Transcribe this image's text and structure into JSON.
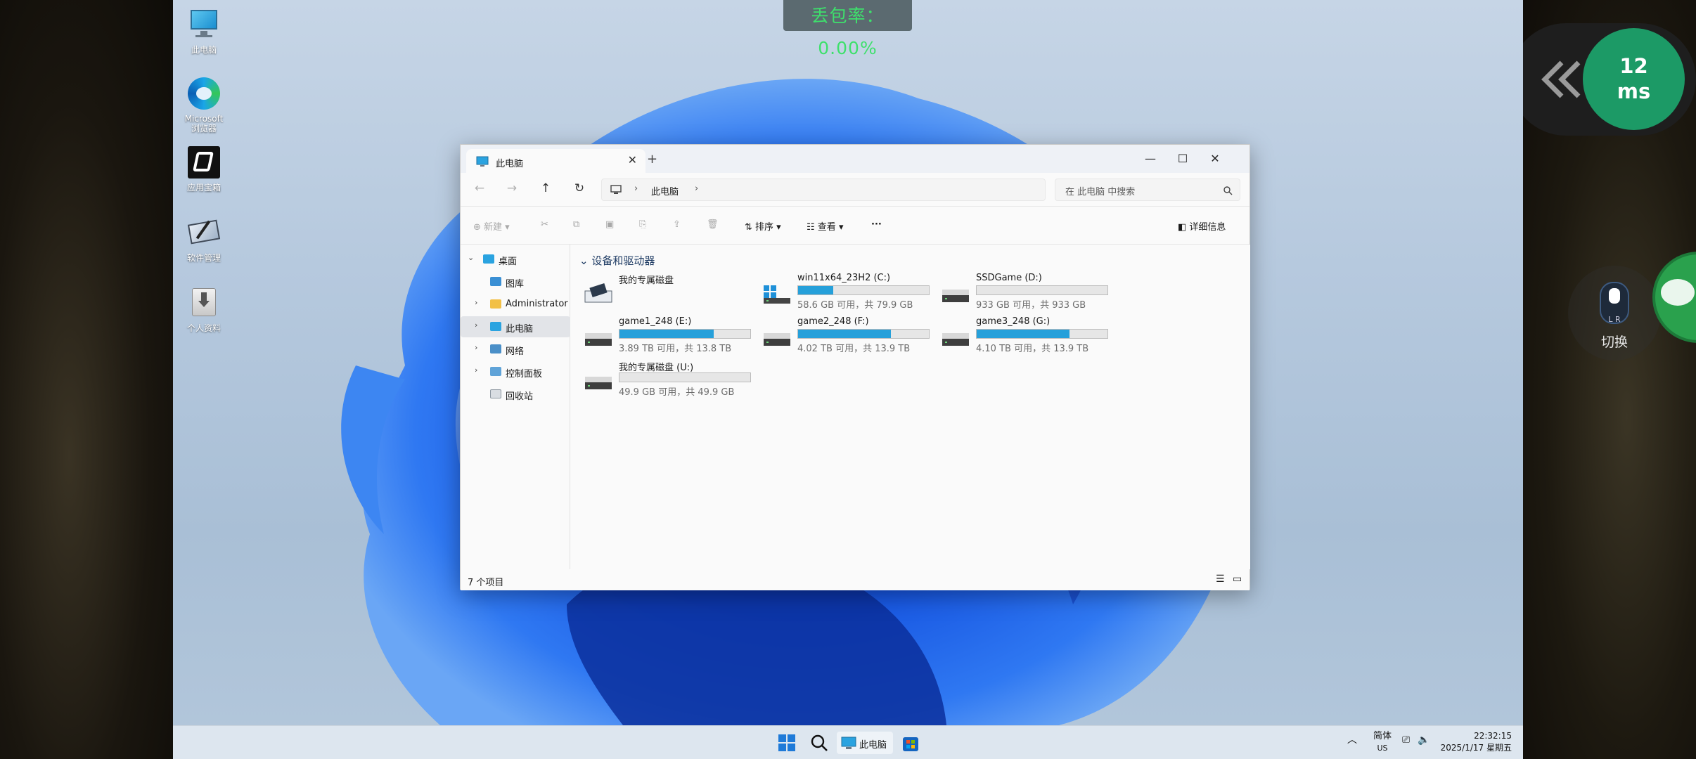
{
  "overlay": {
    "packet_loss": "丢包率：0.00%",
    "latency_value": "12",
    "latency_unit": "ms",
    "switch_label": "切换",
    "switch_badge": "L R"
  },
  "desktop_icons": [
    {
      "label": "此电脑"
    },
    {
      "label": "Microsoft\n浏览器"
    },
    {
      "label": "应用宝箱"
    },
    {
      "label": "软件管理"
    },
    {
      "label": "个人资料"
    }
  ],
  "window": {
    "tab_title": "此电脑",
    "breadcrumb": "此电脑",
    "search_placeholder": "在 此电脑 中搜索",
    "commands": {
      "new": "新建",
      "sort": "排序",
      "view": "查看",
      "more": "···",
      "details": "详细信息"
    },
    "nav_items": [
      {
        "label": "桌面"
      },
      {
        "label": "图库"
      },
      {
        "label": "Administrator"
      },
      {
        "label": "此电脑"
      },
      {
        "label": "网络"
      },
      {
        "label": "控制面板"
      },
      {
        "label": "回收站"
      }
    ],
    "group_title": "设备和驱动器",
    "drives": [
      {
        "name": "我的专属磁盘",
        "info": "",
        "used": null
      },
      {
        "name": "win11x64_23H2 (C:)",
        "info": "58.6 GB 可用，共 79.9 GB",
        "used": 0.27
      },
      {
        "name": "SSDGame (D:)",
        "info": "933 GB 可用，共 933 GB",
        "used": 0.0
      },
      {
        "name": "game1_248 (E:)",
        "info": "3.89 TB 可用，共 13.8 TB",
        "used": 0.72
      },
      {
        "name": "game2_248 (F:)",
        "info": "4.02 TB 可用，共 13.9 TB",
        "used": 0.71
      },
      {
        "name": "game3_248 (G:)",
        "info": "4.10 TB 可用，共 13.9 TB",
        "used": 0.71
      },
      {
        "name": "我的专属磁盘 (U:)",
        "info": "49.9 GB 可用，共 49.9 GB",
        "used": 0.0
      }
    ],
    "status_count": "7 个项目"
  },
  "taskbar": {
    "app_label": "此电脑",
    "ime_top": "简体",
    "ime_bottom": "US",
    "time": "22:32:15",
    "date": "2025/1/17 星期五"
  }
}
